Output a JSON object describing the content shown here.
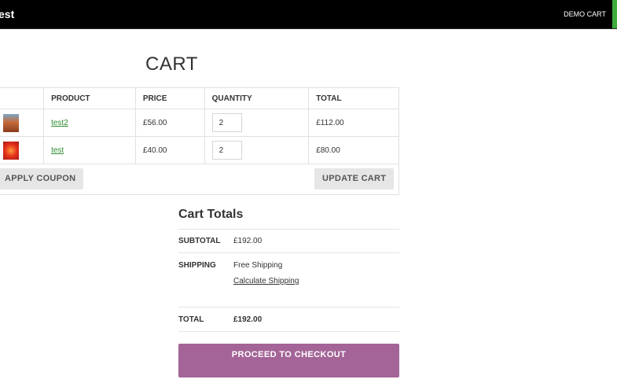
{
  "header": {
    "site_title": "est",
    "nav_link": "DEMO CART"
  },
  "page": {
    "title": "CART"
  },
  "cart_table": {
    "headers": {
      "product": "PRODUCT",
      "price": "PRICE",
      "quantity": "QUANTITY",
      "total": "TOTAL"
    },
    "rows": [
      {
        "thumbnail": "desert-landscape-image",
        "product": "test2",
        "price": "£56.00",
        "quantity": "2",
        "total": "£112.00"
      },
      {
        "thumbnail": "red-flower-image",
        "product": "test",
        "price": "£40.00",
        "quantity": "2",
        "total": "£80.00"
      }
    ],
    "apply_coupon_label": "APPLY COUPON",
    "update_cart_label": "UPDATE CART"
  },
  "cart_totals": {
    "title": "Cart Totals",
    "subtotal_label": "SUBTOTAL",
    "subtotal_value": "£192.00",
    "shipping_label": "SHIPPING",
    "shipping_value": "Free Shipping",
    "calculate_shipping_label": "Calculate Shipping",
    "total_label": "TOTAL",
    "total_value": "£192.00",
    "checkout_label": "PROCEED TO CHECKOUT"
  },
  "colors": {
    "topbar": "#000000",
    "link": "#2e8c2e",
    "checkout_button": "#a46497",
    "secondary_button": "#e6e6e6",
    "accent_stripe": "#3cab3c"
  }
}
